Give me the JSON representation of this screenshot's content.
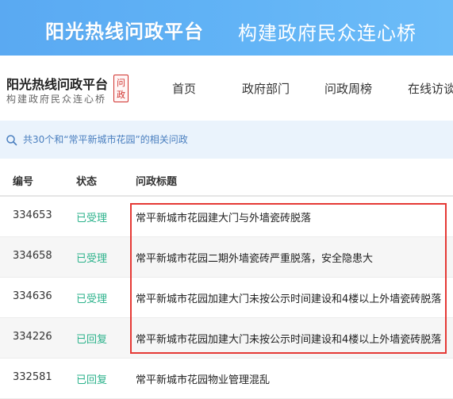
{
  "banner": {
    "title": "阳光热线问政平台",
    "subtitle": "构建政府民众连心桥"
  },
  "logo": {
    "main": "阳光热线问政平台",
    "sub": "构建政府民众连心桥",
    "badge_line1": "问",
    "badge_line2": "政"
  },
  "nav": {
    "items": [
      "首页",
      "政府部门",
      "问政周榜",
      "在线访谈"
    ]
  },
  "result": {
    "icon": "search-icon",
    "text": "共30个和“常平新城市花园”的相关问政"
  },
  "table": {
    "headers": [
      "编号",
      "状态",
      "问政标题"
    ],
    "rows": [
      {
        "id": "334653",
        "status": "已受理",
        "title": "常平新城市花园建大门与外墙瓷砖脱落"
      },
      {
        "id": "334658",
        "status": "已受理",
        "title": "常平新城市花园二期外墙瓷砖严重脱落，安全隐患大"
      },
      {
        "id": "334636",
        "status": "已受理",
        "title": "常平新城市花园加建大门未按公示时间建设和4楼以上外墙瓷砖脱落"
      },
      {
        "id": "334226",
        "status": "已回复",
        "title": "常平新城市花园加建大门未按公示时间建设和4楼以上外墙瓷砖脱落"
      },
      {
        "id": "332581",
        "status": "已回复",
        "title": "常平新城市花园物业管理混乱"
      }
    ]
  },
  "colors": {
    "banner": "#5fb1f5",
    "status_green": "#2bb28b",
    "highlight_red": "#e53935",
    "result_bg": "#eaf3fc"
  }
}
